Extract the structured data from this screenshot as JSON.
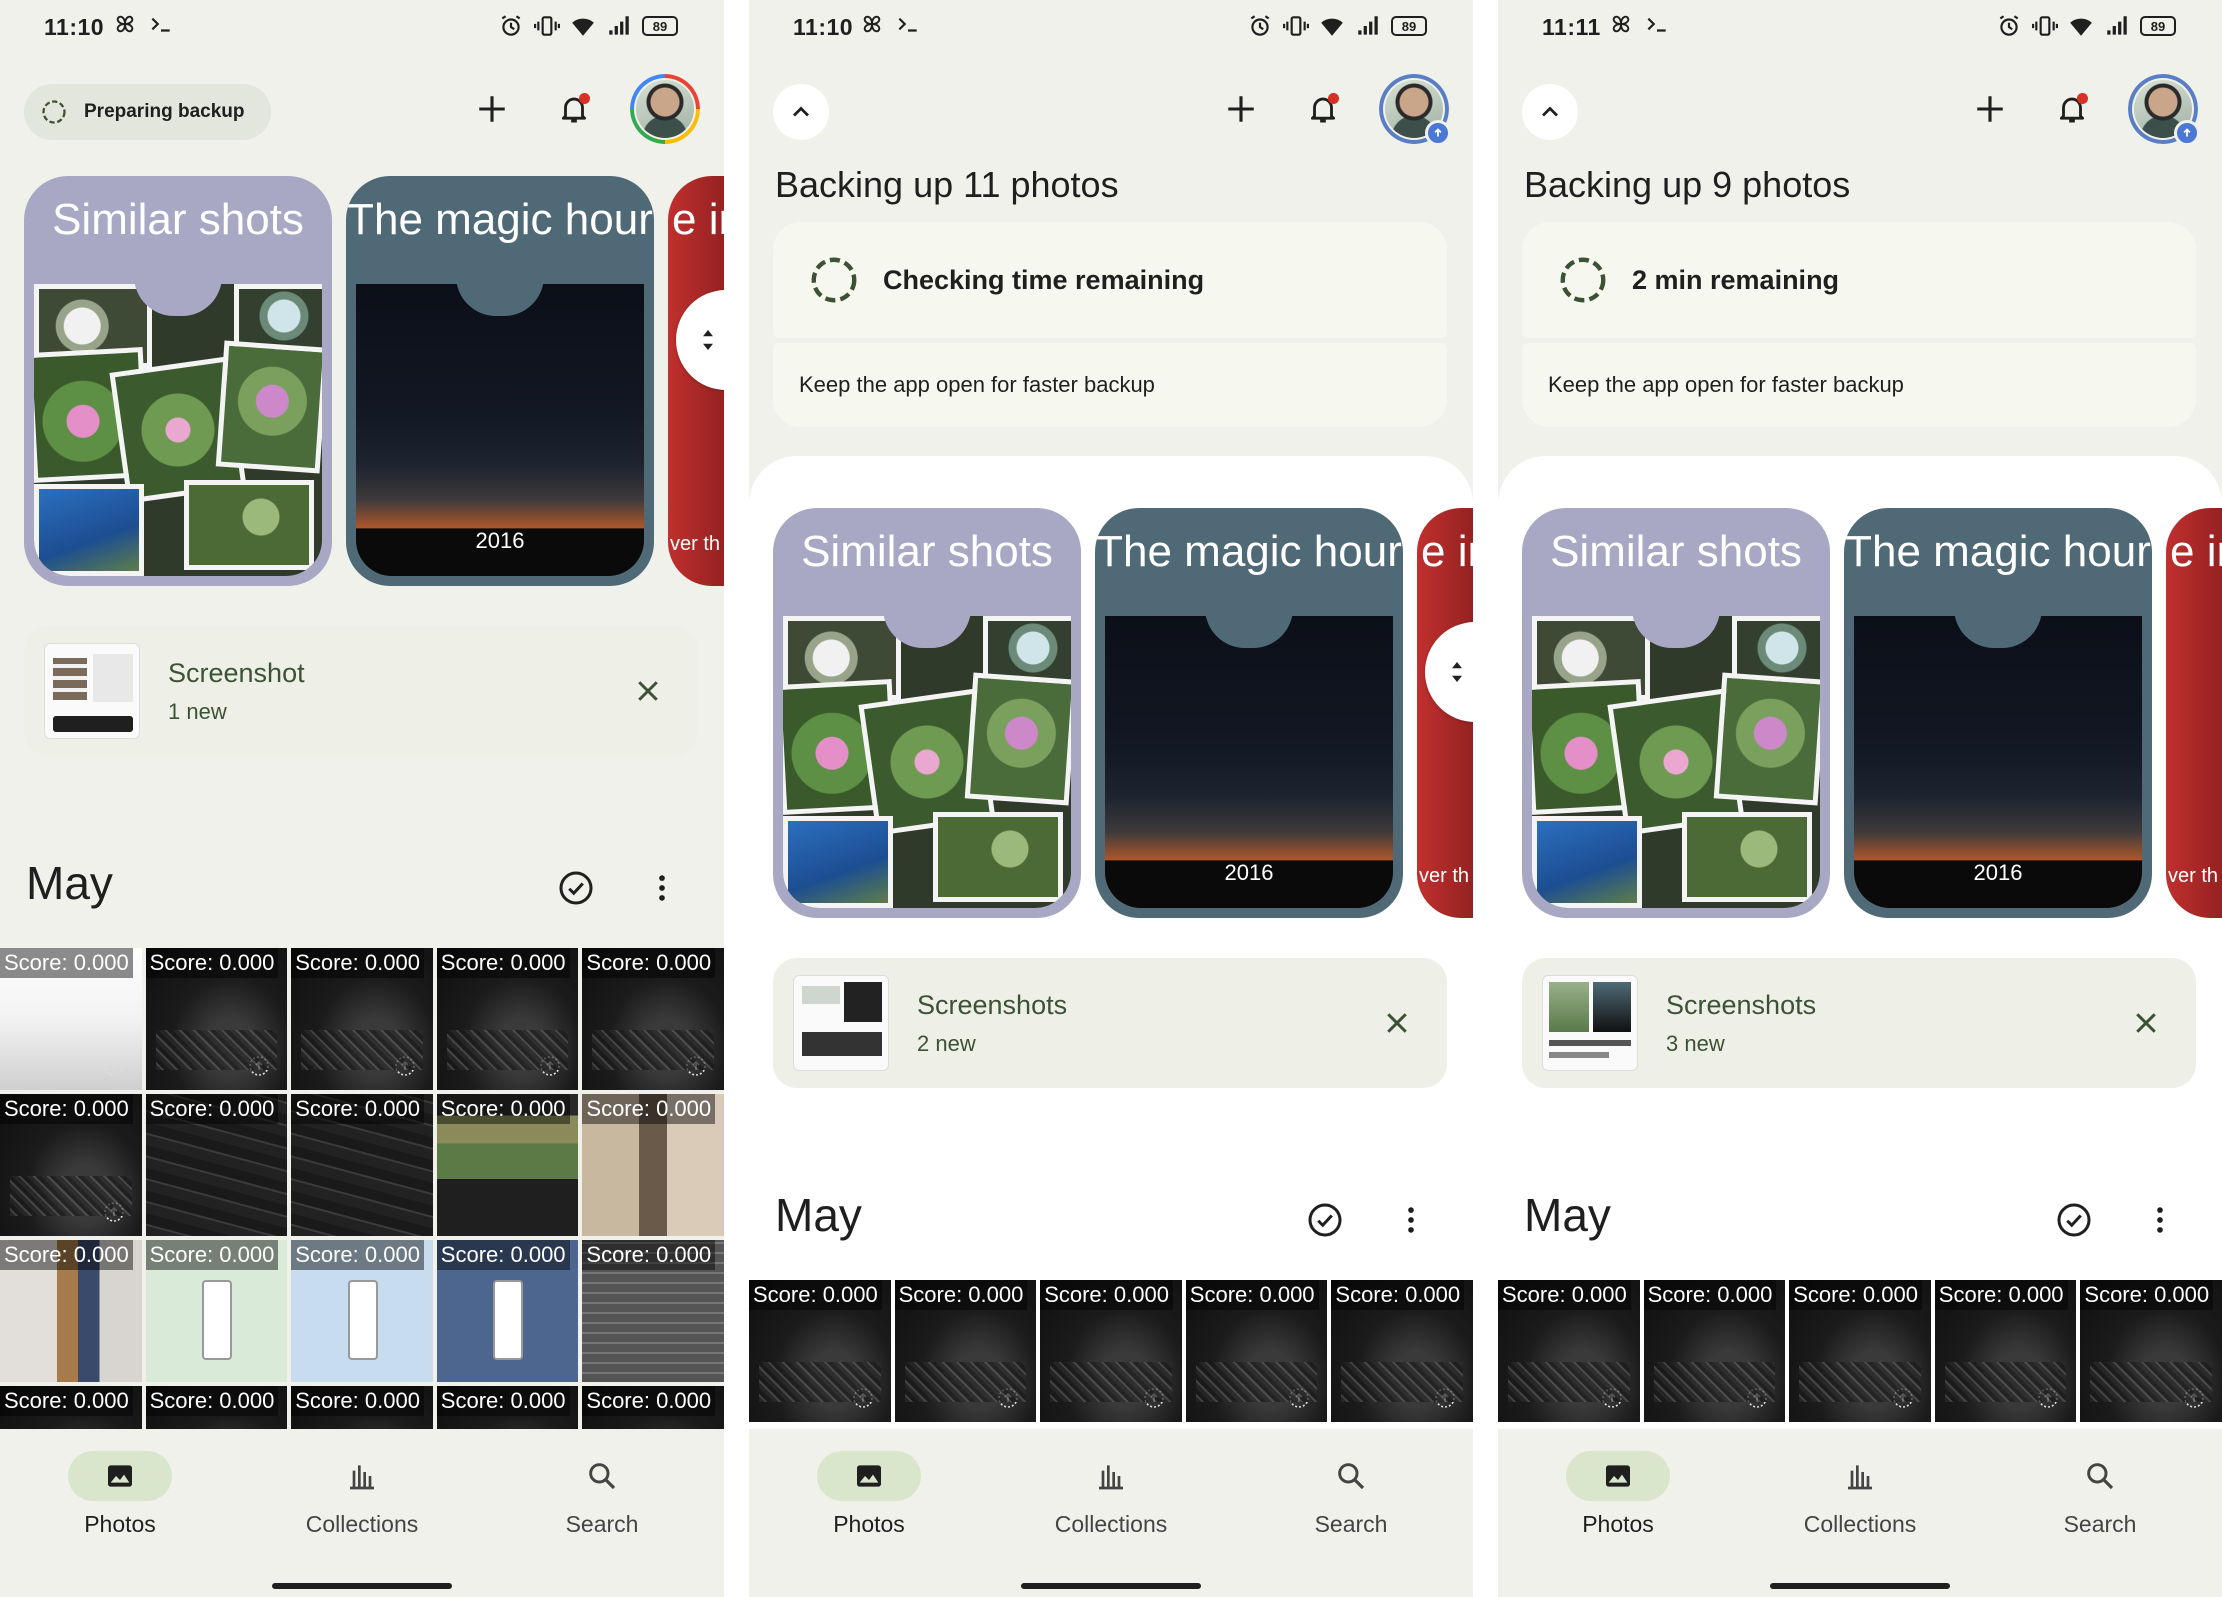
{
  "colors": {
    "accent_green": "#d9e6cb",
    "notification_dot": "#d93025",
    "upload_badge": "#4a78d4",
    "surface": "#f0f1ea"
  },
  "screens": [
    {
      "status_time": "11:10",
      "battery": "89",
      "backup_pill": "Preparing backup",
      "memories": [
        {
          "title": "Similar shots"
        },
        {
          "title": "The magic hour",
          "year": "2016"
        },
        {
          "title": "e in",
          "subtitle": "ver th"
        }
      ],
      "suggestion": {
        "title": "Screenshot",
        "subtitle": "1 new"
      },
      "month": "May",
      "grid_label": "Score: 0.000",
      "nav": {
        "photos": "Photos",
        "collections": "Collections",
        "search": "Search"
      }
    },
    {
      "status_time": "11:10",
      "battery": "89",
      "backup_title": "Backing up 11 photos",
      "backup_status": "Checking time remaining",
      "backup_hint": "Keep the app open for faster backup",
      "memories": [
        {
          "title": "Similar shots"
        },
        {
          "title": "The magic hour",
          "year": "2016"
        },
        {
          "title": "e in",
          "subtitle": "ver th"
        }
      ],
      "suggestion": {
        "title": "Screenshots",
        "subtitle": "2 new"
      },
      "month": "May",
      "grid_label": "Score: 0.000",
      "nav": {
        "photos": "Photos",
        "collections": "Collections",
        "search": "Search"
      }
    },
    {
      "status_time": "11:11",
      "battery": "89",
      "backup_title": "Backing up 9 photos",
      "backup_status": "2 min remaining",
      "backup_hint": "Keep the app open for faster backup",
      "memories": [
        {
          "title": "Similar shots"
        },
        {
          "title": "The magic hour",
          "year": "2016"
        },
        {
          "title": "e in",
          "subtitle": "ver th"
        }
      ],
      "suggestion": {
        "title": "Screenshots",
        "subtitle": "3 new"
      },
      "month": "May",
      "grid_label": "Score: 0.000",
      "nav": {
        "photos": "Photos",
        "collections": "Collections",
        "search": "Search"
      }
    }
  ],
  "icons": {
    "status": [
      "pinwheel-icon",
      "terminal-icon",
      "alarm-icon",
      "vibrate-icon",
      "wifi-icon",
      "signal-icon",
      "battery-icon"
    ],
    "top": [
      "plus-icon",
      "bell-icon",
      "avatar"
    ],
    "grid_cell": "upload-pending-icon",
    "nav": [
      "photo-icon",
      "collections-icon",
      "search-icon"
    ]
  }
}
